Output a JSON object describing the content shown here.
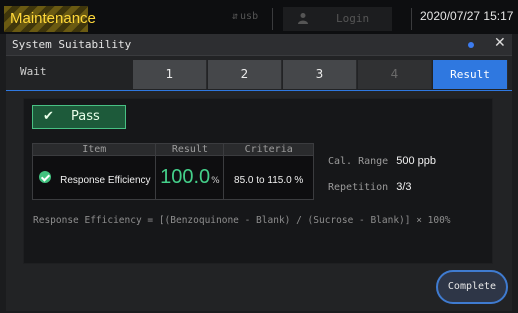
{
  "topbar": {
    "mode_label": "Maintenance",
    "usb_label": "usb",
    "login_label": "Login",
    "datetime": "2020/07/27 15:17"
  },
  "dialog": {
    "title": "System Suitability",
    "tabs": {
      "wait_label": "Wait",
      "items": [
        "1",
        "2",
        "3",
        "4",
        "Result"
      ],
      "active": "Result"
    },
    "result": {
      "status_label": "Pass",
      "table": {
        "headers": [
          "Item",
          "Result",
          "Criteria"
        ],
        "rows": [
          {
            "item": "Response Efficiency",
            "value": "100.0",
            "unit": "%",
            "criteria": "85.0 to 115.0 %"
          }
        ]
      },
      "cal_range_label": "Cal. Range",
      "cal_range_value": "500 ppb",
      "repetition_label": "Repetition",
      "repetition_value": "3/3",
      "formula": "Response Efficiency = [(Benzoquinone - Blank) / (Sucrose - Blank)] × 100%"
    },
    "complete_label": "Complete"
  },
  "colors": {
    "accent": "#2f78e0",
    "pass_green": "#44d08a",
    "maintenance_yellow": "#ffd83a"
  }
}
